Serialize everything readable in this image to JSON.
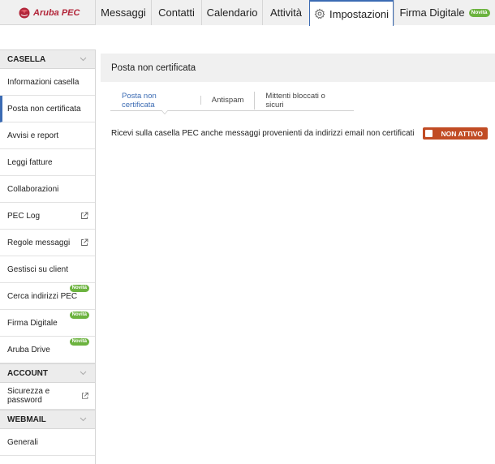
{
  "brand": {
    "name": "Aruba PEC",
    "color": "#b2263a"
  },
  "nav": {
    "tabs": [
      {
        "label": "Messaggi"
      },
      {
        "label": "Contatti"
      },
      {
        "label": "Calendario"
      },
      {
        "label": "Attività"
      },
      {
        "label": "Impostazioni",
        "active": true,
        "icon": "gear-icon"
      },
      {
        "label": "Firma Digitale",
        "badge": "Novità"
      }
    ]
  },
  "sidebar": {
    "sections": [
      {
        "title": "CASELLA",
        "items": [
          {
            "label": "Informazioni casella"
          },
          {
            "label": "Posta non certificata",
            "active": true
          },
          {
            "label": "Avvisi e report"
          },
          {
            "label": "Leggi fatture"
          },
          {
            "label": "Collaborazioni"
          },
          {
            "label": "PEC Log",
            "icon": "external-link-icon"
          },
          {
            "label": "Regole messaggi",
            "icon": "external-link-icon"
          },
          {
            "label": "Gestisci su client"
          },
          {
            "label": "Cerca indirizzi PEC",
            "badge": "Novità"
          },
          {
            "label": "Firma Digitale",
            "badge": "Novità"
          },
          {
            "label": "Aruba Drive",
            "badge": "Novità"
          }
        ]
      },
      {
        "title": "ACCOUNT",
        "items": [
          {
            "label": "Sicurezza e password",
            "icon": "external-link-icon"
          }
        ]
      },
      {
        "title": "WEBMAIL",
        "items": [
          {
            "label": "Generali"
          }
        ]
      }
    ]
  },
  "main": {
    "title": "Posta non certificata",
    "subtabs": [
      {
        "label": "Posta non certificata",
        "active": true
      },
      {
        "label": "Antispam"
      },
      {
        "label": "Mittenti bloccati o sicuri"
      }
    ],
    "setting": {
      "label": "Ricevi sulla casella PEC anche messaggi provenienti da indirizzi email non certificati",
      "toggle_label": "NON ATTIVO",
      "toggle_color": "#c14c24"
    }
  },
  "colors": {
    "accent": "#3b6bb3",
    "badge": "#6cb33f"
  }
}
